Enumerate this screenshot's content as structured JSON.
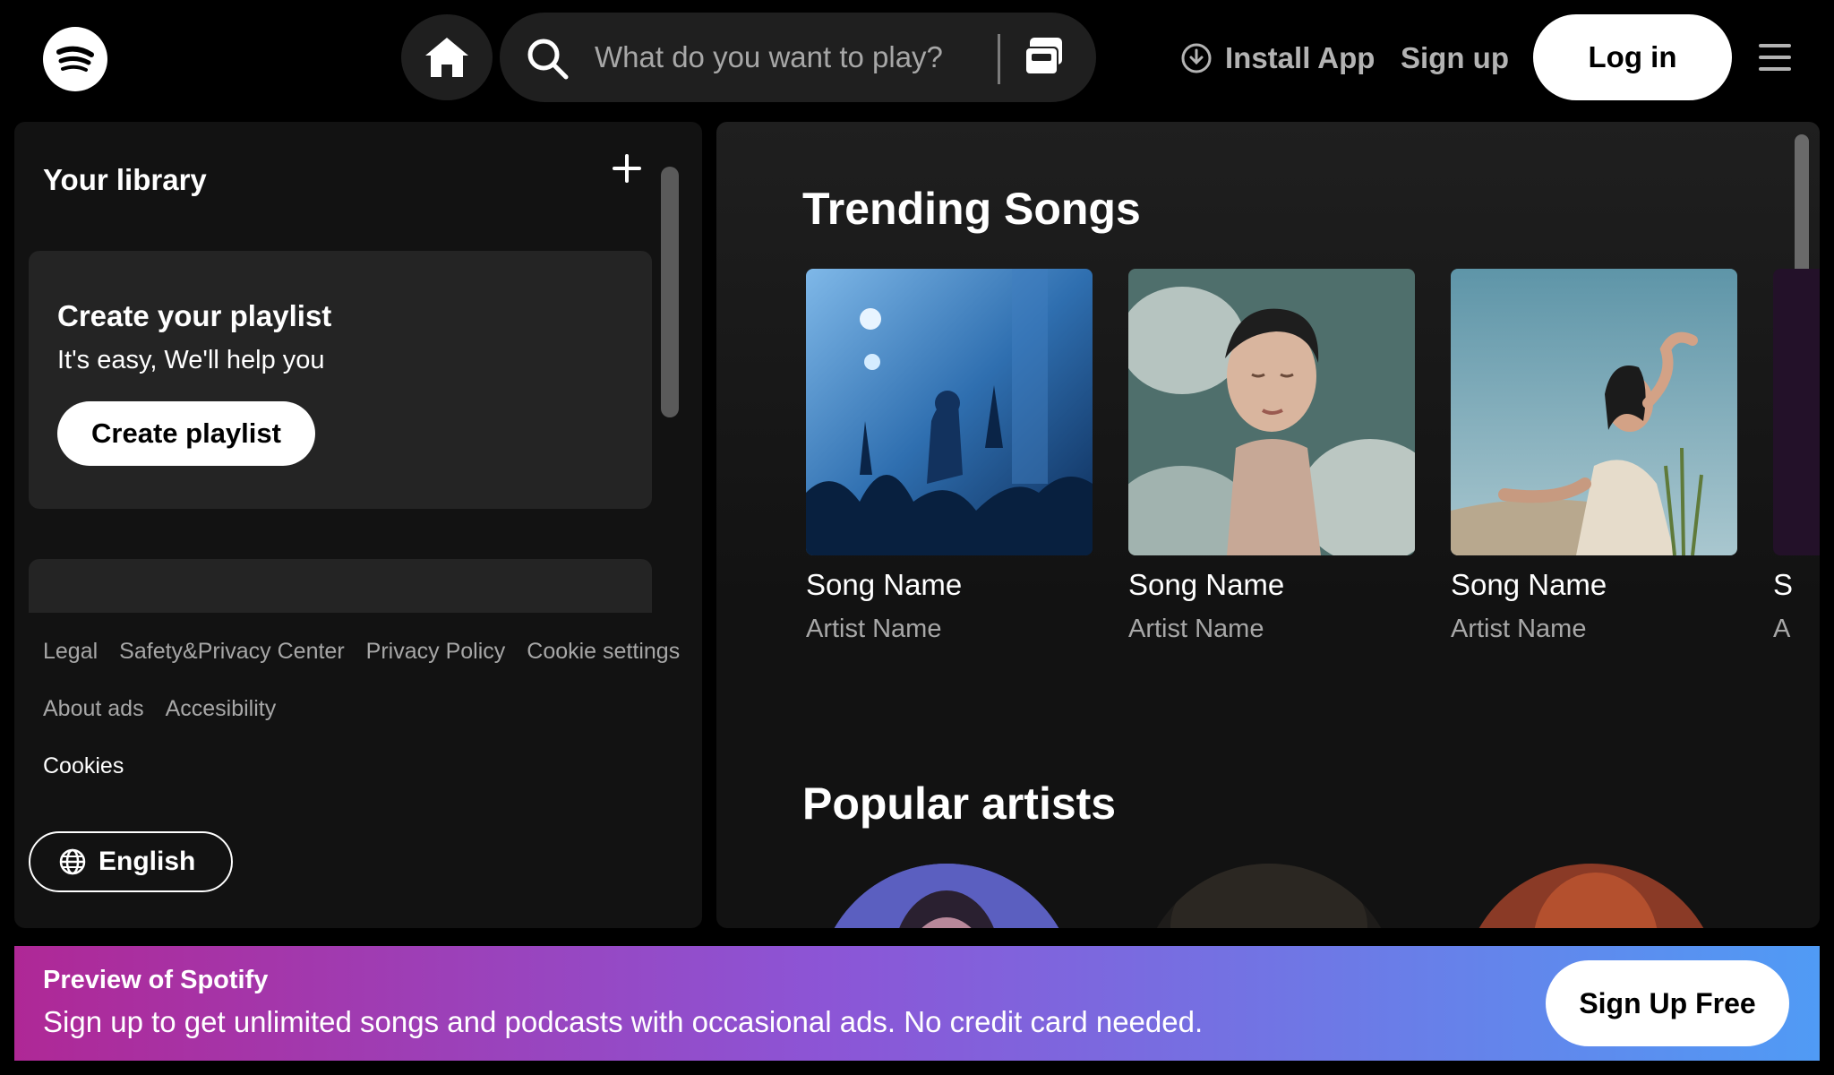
{
  "header": {
    "search_placeholder": "What do you want to play?",
    "install_app": "Install App",
    "sign_up": "Sign up",
    "log_in": "Log in"
  },
  "library": {
    "title": "Your library",
    "create_card": {
      "title": "Create your playlist",
      "subtitle": "It's easy, We'll help you",
      "button": "Create playlist"
    },
    "footer_links": [
      "Legal",
      "Safety&Privacy Center",
      "Privacy Policy",
      "Cookie settings",
      "About ads",
      "Accesibility",
      "Cookies"
    ],
    "language": "English"
  },
  "main": {
    "trending_title": "Trending Songs",
    "songs": [
      {
        "name": "Song Name",
        "artist": "Artist Name",
        "cover": "concert-crowd-image"
      },
      {
        "name": "Song Name",
        "artist": "Artist Name",
        "cover": "person-in-water-image"
      },
      {
        "name": "Song Name",
        "artist": "Artist Name",
        "cover": "woman-in-sun-image"
      }
    ],
    "peek_song": {
      "name": "S",
      "artist": "A"
    },
    "popular_title": "Popular artists"
  },
  "banner": {
    "title": "Preview of Spotify",
    "text": "Sign up to get unlimited songs and podcasts with occasional ads. No credit card needed.",
    "button": "Sign Up Free"
  },
  "colors": {
    "accent_banner_start": "#af2896",
    "accent_banner_end": "#509bf5",
    "surface": "#121212",
    "card": "#242424"
  }
}
